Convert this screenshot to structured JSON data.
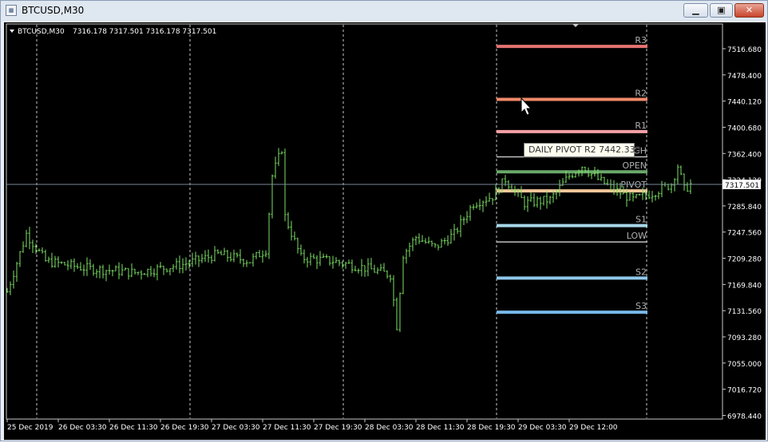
{
  "window": {
    "title": "BTCUSD,M30",
    "app_icon": "chart-window-icon",
    "buttons": {
      "minimize": "minimize-icon",
      "maximize": "maximize-icon",
      "close": "close-icon"
    }
  },
  "header": {
    "symbol": "BTCUSD,M30",
    "quote": "7316.178 7317.501 7316.178 7317.501"
  },
  "tooltip": {
    "text": "DAILY PIVOT R2 7442.330"
  },
  "colors": {
    "background": "#000000",
    "candle": "#7ddf64",
    "grid": "#c8c8c8",
    "price_line": "#778899",
    "r3": "#e57373",
    "r2": "#f08a6a",
    "r1": "#f4a0a8",
    "high": "#c0c0c0",
    "open": "#6aa86a",
    "pivot": "#f6c79a",
    "s1": "#a8d8ea",
    "low": "#c0c0c0",
    "s2": "#8ec8ea",
    "s3": "#7ab8ea"
  },
  "chart_data": {
    "type": "candlestick",
    "title": "BTCUSD,M30",
    "xlabel": "",
    "ylabel": "",
    "ylim": [
      6960,
      7560
    ],
    "y_ticks": [
      "7516.680",
      "7478.400",
      "7440.120",
      "7400.680",
      "7362.400",
      "7324.120",
      "7285.840",
      "7247.560",
      "7209.280",
      "7169.840",
      "7131.560",
      "7093.280",
      "7055.000",
      "7016.720",
      "6978.440"
    ],
    "x_ticks": [
      "25 Dec 2019",
      "26 Dec 03:30",
      "26 Dec 11:30",
      "26 Dec 19:30",
      "27 Dec 03:30",
      "27 Dec 11:30",
      "27 Dec 19:30",
      "28 Dec 03:30",
      "28 Dec 11:30",
      "28 Dec 19:30",
      "29 Dec 03:30",
      "29 Dec 12:00"
    ],
    "day_separators": [
      "25 Dec 2019",
      "26 Dec",
      "27 Dec",
      "28 Dec",
      "29 Dec",
      "29 Dec 12:00"
    ],
    "current_price": "7317.501",
    "pivot_levels": [
      {
        "label": "R3",
        "value": 7520,
        "color_key": "r3",
        "thick": true
      },
      {
        "label": "R2",
        "value": 7442.33,
        "color_key": "r2",
        "thick": true
      },
      {
        "label": "R1",
        "value": 7395,
        "color_key": "r1",
        "thick": true
      },
      {
        "label": "HIGH",
        "value": 7358,
        "color_key": "high",
        "thick": false
      },
      {
        "label": "OPEN",
        "value": 7336,
        "color_key": "open",
        "thick": true
      },
      {
        "label": "PIVOT",
        "value": 7308,
        "color_key": "pivot",
        "thick": true
      },
      {
        "label": "S1",
        "value": 7257,
        "color_key": "s1",
        "thick": true
      },
      {
        "label": "LOW",
        "value": 7233,
        "color_key": "low",
        "thick": false
      },
      {
        "label": "S2",
        "value": 7180,
        "color_key": "s2",
        "thick": true
      },
      {
        "label": "S3",
        "value": 7130,
        "color_key": "s3",
        "thick": true
      }
    ],
    "price_path": [
      {
        "x": "25 Dec 00:00",
        "y": 7160
      },
      {
        "x": "25 Dec 03:00",
        "y": 7245
      },
      {
        "x": "25 Dec 06:00",
        "y": 7205
      },
      {
        "x": "25 Dec 12:00",
        "y": 7195
      },
      {
        "x": "25 Dec 20:00",
        "y": 7188
      },
      {
        "x": "26 Dec 03:30",
        "y": 7200
      },
      {
        "x": "26 Dec 09:00",
        "y": 7215
      },
      {
        "x": "26 Dec 14:00",
        "y": 7205
      },
      {
        "x": "26 Dec 16:30",
        "y": 7222
      },
      {
        "x": "26 Dec 17:30",
        "y": 7330
      },
      {
        "x": "26 Dec 19:00",
        "y": 7370
      },
      {
        "x": "26 Dec 19:30",
        "y": 7270
      },
      {
        "x": "26 Dec 22:00",
        "y": 7210
      },
      {
        "x": "27 Dec 03:00",
        "y": 7205
      },
      {
        "x": "27 Dec 08:00",
        "y": 7195
      },
      {
        "x": "27 Dec 12:00",
        "y": 7185
      },
      {
        "x": "27 Dec 13:00",
        "y": 7110
      },
      {
        "x": "27 Dec 14:00",
        "y": 7215
      },
      {
        "x": "27 Dec 16:00",
        "y": 7240
      },
      {
        "x": "27 Dec 19:00",
        "y": 7225
      },
      {
        "x": "27 Dec 22:00",
        "y": 7245
      },
      {
        "x": "28 Dec 01:00",
        "y": 7290
      },
      {
        "x": "28 Dec 04:00",
        "y": 7300
      },
      {
        "x": "28 Dec 06:00",
        "y": 7325
      },
      {
        "x": "28 Dec 09:00",
        "y": 7290
      },
      {
        "x": "28 Dec 13:00",
        "y": 7295
      },
      {
        "x": "28 Dec 16:00",
        "y": 7330
      },
      {
        "x": "28 Dec 18:00",
        "y": 7345
      },
      {
        "x": "28 Dec 20:30",
        "y": 7325
      },
      {
        "x": "28 Dec 23:00",
        "y": 7310
      },
      {
        "x": "29 Dec 02:00",
        "y": 7295
      },
      {
        "x": "29 Dec 05:00",
        "y": 7305
      },
      {
        "x": "29 Dec 08:00",
        "y": 7318
      },
      {
        "x": "29 Dec 09:00",
        "y": 7345
      },
      {
        "x": "29 Dec 10:00",
        "y": 7310
      },
      {
        "x": "29 Dec 11:00",
        "y": 7317.5
      }
    ]
  }
}
